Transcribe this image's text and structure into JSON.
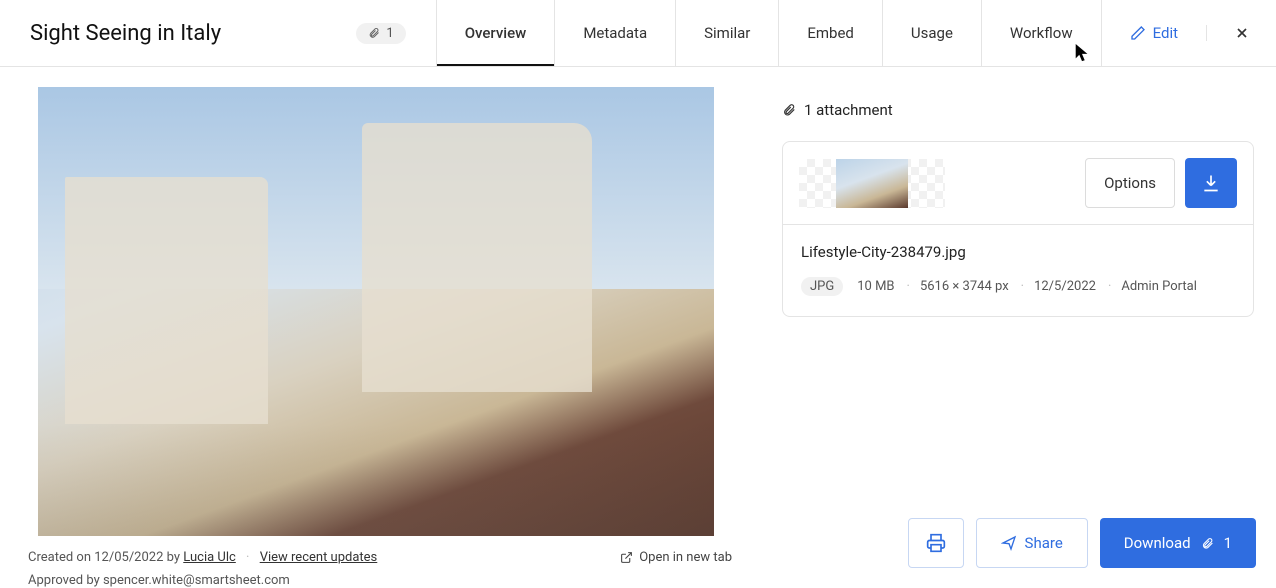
{
  "header": {
    "title": "Sight Seeing in Italy",
    "attachment_count": "1",
    "tabs": {
      "overview": "Overview",
      "metadata": "Metadata",
      "similar": "Similar",
      "embed": "Embed",
      "usage": "Usage",
      "workflow": "Workflow",
      "edit": "Edit"
    }
  },
  "image_info": {
    "created_prefix": "Created on ",
    "created_date": "12/05/2022",
    "by_word": " by ",
    "author": "Lucia Ulc",
    "recent_updates": "View recent updates",
    "approved_prefix": "Approved by ",
    "approved_by": "spencer.white@smartsheet.com",
    "open_new_tab": "Open in new tab"
  },
  "attachments": {
    "header": "1 attachment",
    "card": {
      "options_label": "Options",
      "filename": "Lifestyle-City-238479.jpg",
      "format": "JPG",
      "size": "10 MB",
      "dimensions": "5616 × 3744 px",
      "date": "12/5/2022",
      "source": "Admin Portal"
    }
  },
  "footer": {
    "share": "Share",
    "download": "Download",
    "download_count": "1"
  }
}
